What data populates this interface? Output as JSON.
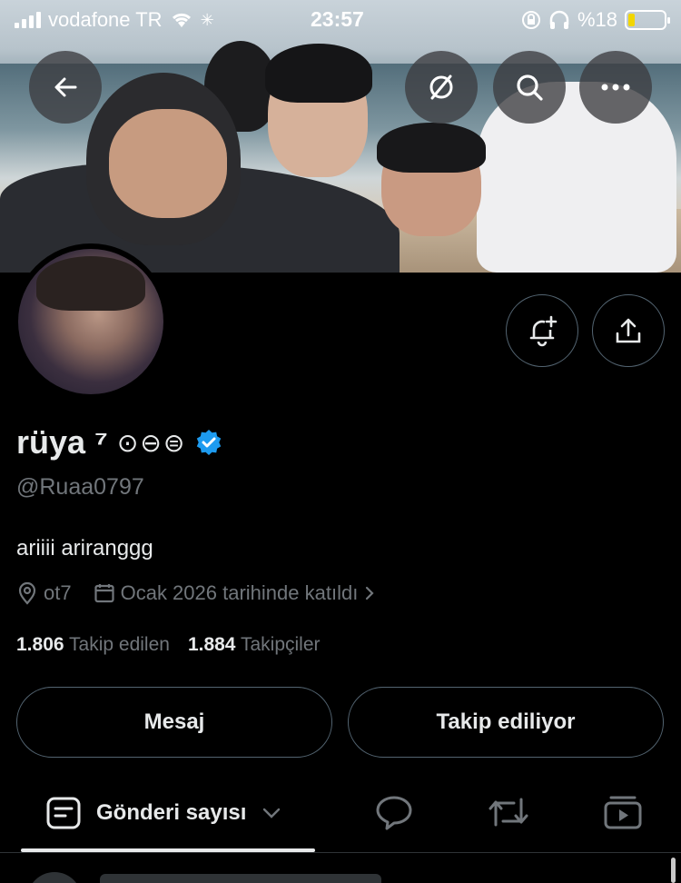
{
  "status_bar": {
    "carrier": "vodafone TR",
    "time": "23:57",
    "battery_percent": "%18",
    "battery_level": 0.18,
    "battery_color": "#f2d600"
  },
  "header_buttons": {
    "back_icon": "arrow-left-icon",
    "grok_icon": "slash-circle-icon",
    "search_icon": "search-icon",
    "more_icon": "more-horizontal-icon"
  },
  "profile": {
    "display_name": "rüya ⁷",
    "name_symbols": "⊙⊖⊜",
    "verified": true,
    "verified_color": "#1d9bf0",
    "handle": "@Ruaa0797",
    "bio": "ariiii ariranggg",
    "location": "ot7",
    "joined": "Ocak 2026 tarihinde katıldı",
    "following_count": "1.806",
    "following_label": "Takip edilen",
    "followers_count": "1.884",
    "followers_label": "Takipçiler"
  },
  "actions": {
    "notify_icon": "bell-plus-icon",
    "share_icon": "share-icon",
    "message_label": "Mesaj",
    "following_button_label": "Takip ediliyor"
  },
  "tabs": {
    "selected_label": "Gönderi sayısı",
    "icons": [
      "reply-bubble-icon",
      "retweet-icon",
      "media-icon"
    ]
  }
}
